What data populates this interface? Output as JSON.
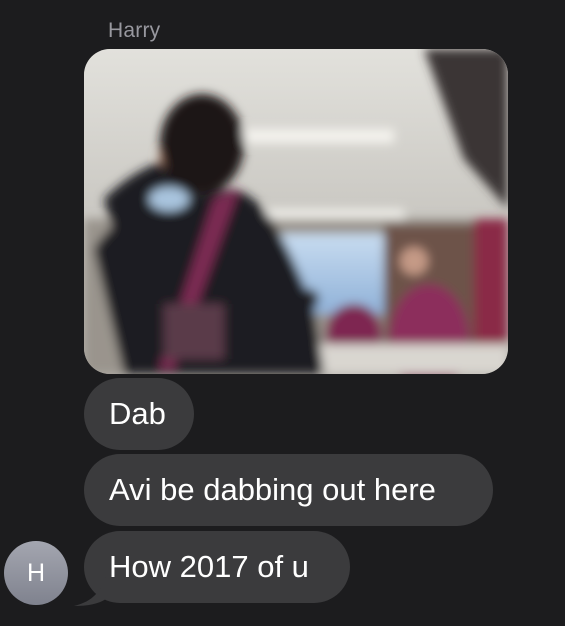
{
  "conversation": {
    "sender_name": "Harry",
    "sender_initial": "H",
    "messages": [
      {
        "text": "Dab"
      },
      {
        "text": "Avi be dabbing out here"
      },
      {
        "text": "How 2017 of u"
      }
    ]
  }
}
